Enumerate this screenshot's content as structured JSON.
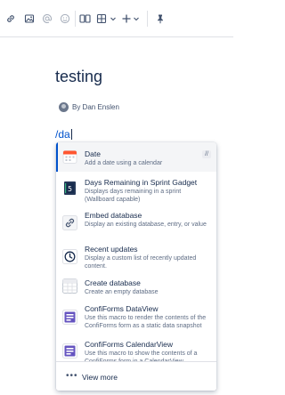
{
  "toolbar": {
    "buttons": [
      "link-icon",
      "image-icon",
      "mention-icon",
      "emoji-icon",
      "layouts-icon",
      "table-icon",
      "insert-icon",
      "pin-icon"
    ]
  },
  "page": {
    "title": "testing",
    "byline": "By Dan Enslen",
    "typed_text": "/da"
  },
  "menu": {
    "items": [
      {
        "title": "Date",
        "description": "Add a date using a calendar",
        "shortcut": "//",
        "icon": "calendar-icon",
        "selected": true
      },
      {
        "title": "Days Remaining in Sprint Gadget",
        "description": "Displays days remaining in a sprint (Wallboard capable)",
        "icon": "sprint-gadget-icon"
      },
      {
        "title": "Embed database",
        "description": "Display an existing database, entry, or value",
        "icon": "link-icon"
      },
      {
        "title": "Recent updates",
        "description": "Display a custom list of recently updated content.",
        "icon": "clock-icon"
      },
      {
        "title": "Create database",
        "description": "Create an empty database",
        "icon": "database-grid-icon"
      },
      {
        "title": "ConfiForms DataView",
        "description": "Use this macro to render the contents of the ConfiForms form as a static data snapshot",
        "icon": "confiforms-icon"
      },
      {
        "title": "ConfiForms CalendarView",
        "description": "Use this macro to show the contents of a ConfiForms form in a CalendarView",
        "icon": "confiforms-calendar-icon"
      }
    ],
    "view_more": "View more"
  },
  "colors": {
    "accent": "#0052cc",
    "text": "#172b4d",
    "muted": "#5e6c84",
    "selected_bg": "#f4f5f7"
  }
}
